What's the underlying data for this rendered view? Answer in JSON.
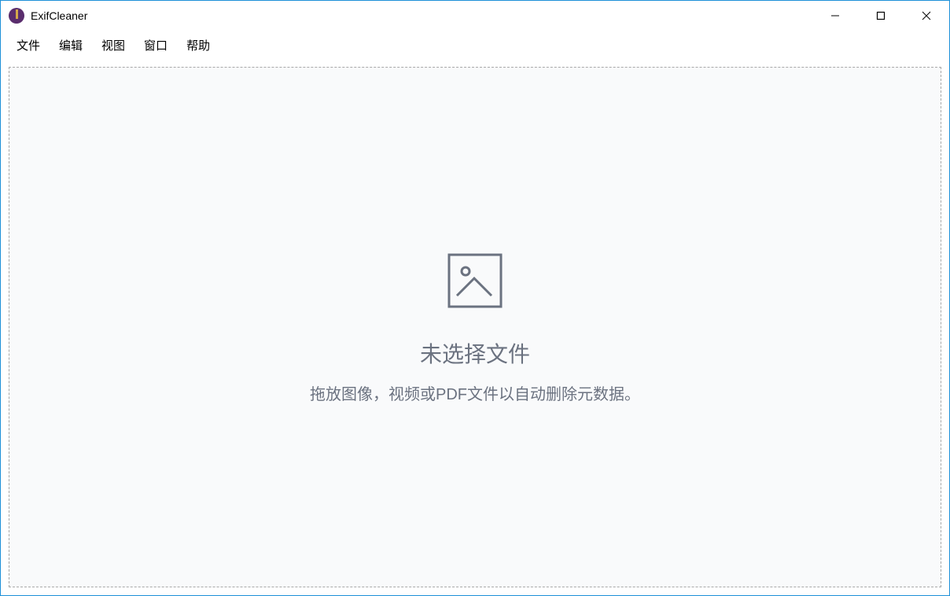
{
  "titlebar": {
    "app_title": "ExifCleaner"
  },
  "menubar": {
    "items": [
      "文件",
      "编辑",
      "视图",
      "窗口",
      "帮助"
    ]
  },
  "dropzone": {
    "title": "未选择文件",
    "subtitle": "拖放图像，视频或PDF文件以自动删除元数据。"
  }
}
